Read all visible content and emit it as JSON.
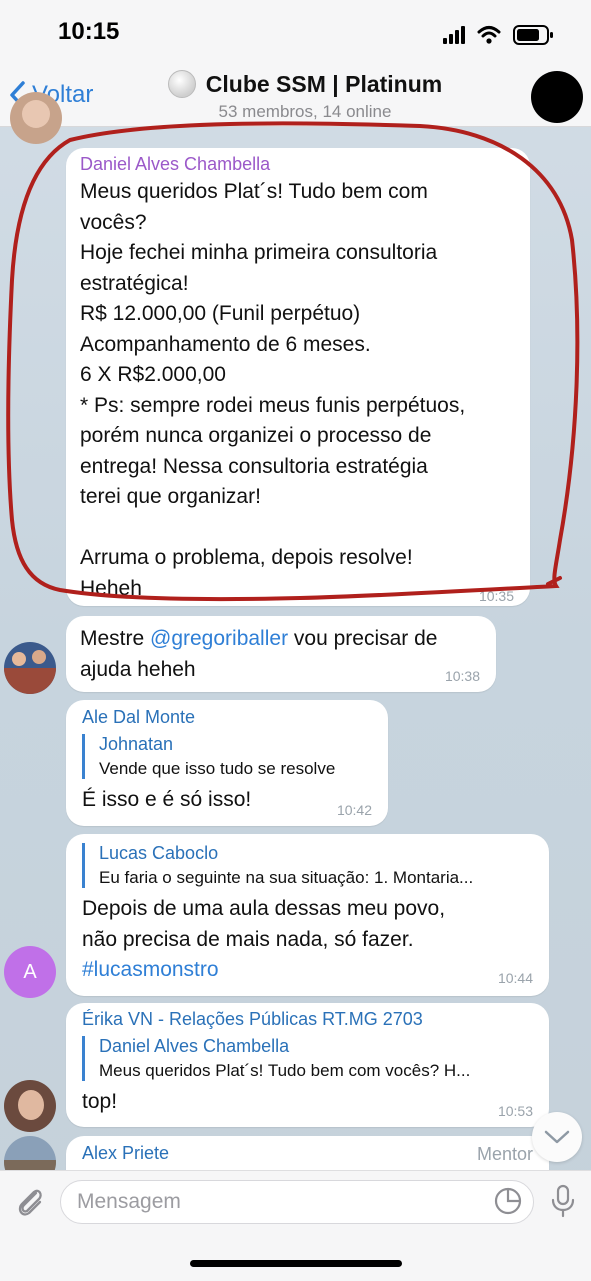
{
  "status_bar": {
    "time": "10:15"
  },
  "header": {
    "back_label": "Voltar",
    "title": "Clube SSM | Platinum",
    "subtitle": "53 membros, 14 online"
  },
  "messages": [
    {
      "sender": "Daniel Alves Chambella",
      "sender_color": "#9b59c9",
      "text": "Meus queridos Plat´s! Tudo bem com\nvocês?\nHoje fechei minha primeira consultoria\nestratégica!\nR$ 12.000,00 (Funil perpétuo)\nAcompanhamento de 6 meses.\n6 X R$2.000,00\n* Ps: sempre rodei meus funis perpétuos,\nporém nunca organizei o processo de\nentrega! Nessa consultoria estratégia\nterei que organizar!\n\nArruma o problema, depois resolve!\nHeheh",
      "time": "10:35"
    },
    {
      "text_prefix": "Mestre ",
      "mention": "@gregoriballer",
      "text_suffix": " vou precisar de\najuda heheh",
      "time": "10:38"
    },
    {
      "sender": "Ale Dal Monte",
      "sender_color": "#2a71b8",
      "reply_name": "Johnatan",
      "reply_text": "Vende que isso tudo se resolve",
      "text": "É isso e é só isso!",
      "time": "10:42"
    },
    {
      "reply_name": "Lucas Caboclo",
      "reply_text": "Eu faria o seguinte na sua situação:  1. Montaria...",
      "text": "Depois de uma aula dessas meu povo,\nnão precisa de mais nada, só fazer.",
      "hashtag": "#lucasmonstro",
      "time": "10:44",
      "avatar_letter": "A"
    },
    {
      "sender": "Érika VN - Relações Públicas RT.MG 2703",
      "sender_color": "#2a71b8",
      "reply_name": "Daniel Alves Chambella",
      "reply_text": "Meus queridos Plat´s! Tudo bem com vocês? H...",
      "text": "top!",
      "time": "10:53"
    },
    {
      "sender": "Alex Priete",
      "sender_color": "#2a71b8",
      "role": "Mentor"
    }
  ],
  "composer": {
    "placeholder": "Mensagem"
  },
  "colors": {
    "accent": "#2f7fd6",
    "annotation_red": "#b0201c",
    "avatar_purple": "#c070e8"
  }
}
